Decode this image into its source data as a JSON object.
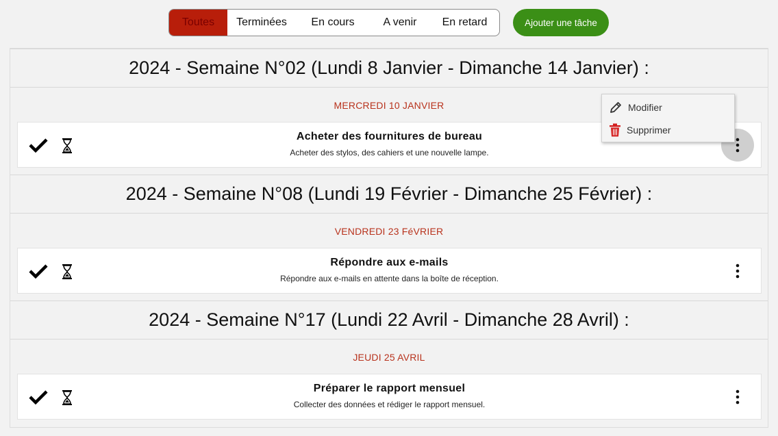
{
  "filters": {
    "tabs": [
      {
        "label": "Toutes",
        "active": true
      },
      {
        "label": "Terminées",
        "active": false
      },
      {
        "label": "En cours",
        "active": false
      },
      {
        "label": "A venir",
        "active": false
      },
      {
        "label": "En retard",
        "active": false
      }
    ]
  },
  "add_task_label": "Ajouter une tâche",
  "weeks": [
    {
      "title": "2024 - Semaine N°02 (Lundi 8 Janvier - Dimanche 14 Janvier) :",
      "day": "MERCREDI 10 JANVIER",
      "task": {
        "title": "Acheter des fournitures de bureau",
        "description": "Acheter des stylos, des cahiers et une nouvelle lampe."
      }
    },
    {
      "title": "2024 - Semaine N°08 (Lundi 19 Février - Dimanche 25 Février) :",
      "day": "VENDREDI 23 FéVRIER",
      "task": {
        "title": "Répondre aux e-mails",
        "description": "Répondre aux e-mails en attente dans la boîte de réception."
      }
    },
    {
      "title": "2024 - Semaine N°17 (Lundi 22 Avril - Dimanche 28 Avril) :",
      "day": "JEUDI 25 AVRIL",
      "task": {
        "title": "Préparer le rapport mensuel",
        "description": "Collecter des données et rédiger le rapport mensuel."
      }
    }
  ],
  "context_menu": {
    "edit_label": "Modifier",
    "delete_label": "Supprimer"
  },
  "colors": {
    "active_tab": "#b81e0a",
    "add_button": "#3b8f16",
    "day_label": "#b8321c",
    "delete_icon": "#d42020"
  }
}
